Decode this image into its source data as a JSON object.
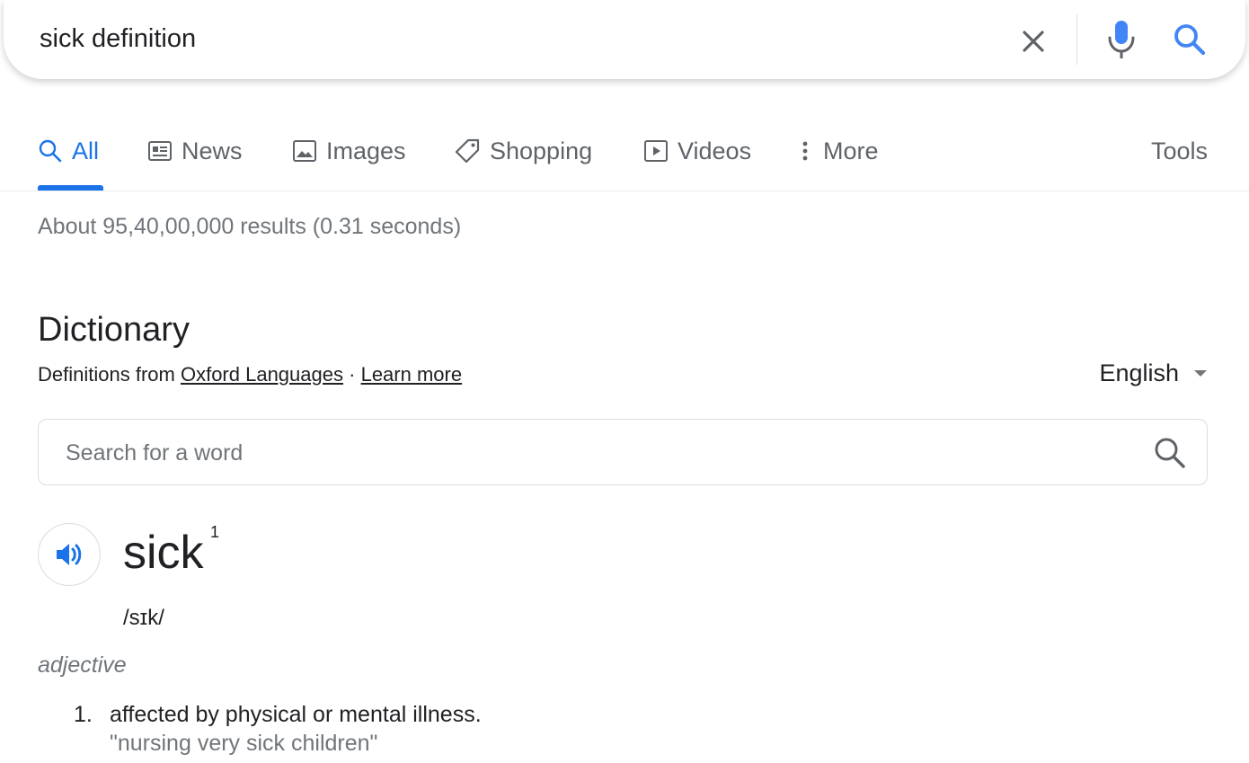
{
  "search": {
    "query": "sick definition",
    "clear_icon": "close-icon",
    "mic_icon": "mic-icon",
    "search_icon": "search-icon"
  },
  "tabs": [
    {
      "label": "All",
      "icon": "search-icon",
      "active": true
    },
    {
      "label": "News",
      "icon": "news-icon",
      "active": false
    },
    {
      "label": "Images",
      "icon": "image-icon",
      "active": false
    },
    {
      "label": "Shopping",
      "icon": "tag-icon",
      "active": false
    },
    {
      "label": "Videos",
      "icon": "play-icon",
      "active": false
    },
    {
      "label": "More",
      "icon": "more-vert-icon",
      "active": false
    }
  ],
  "tools_label": "Tools",
  "stats": "About 95,40,00,000 results (0.31 seconds)",
  "dictionary": {
    "title": "Dictionary",
    "source_prefix": "Definitions from",
    "source_link": "Oxford Languages",
    "separator": "·",
    "learn_more": "Learn more",
    "language": "English",
    "word_search_placeholder": "Search for a word",
    "headword": "sick",
    "headword_sup": "1",
    "phonetic": "/sɪk/",
    "part_of_speech": "adjective",
    "definitions": [
      {
        "number": "1.",
        "text": "affected by physical or mental illness.",
        "example": "\"nursing very sick children\""
      }
    ]
  },
  "colors": {
    "accent": "#1a73e8",
    "text": "#202124",
    "muted": "#70757a",
    "tab_inactive": "#5f6368",
    "border": "#dadce0"
  }
}
